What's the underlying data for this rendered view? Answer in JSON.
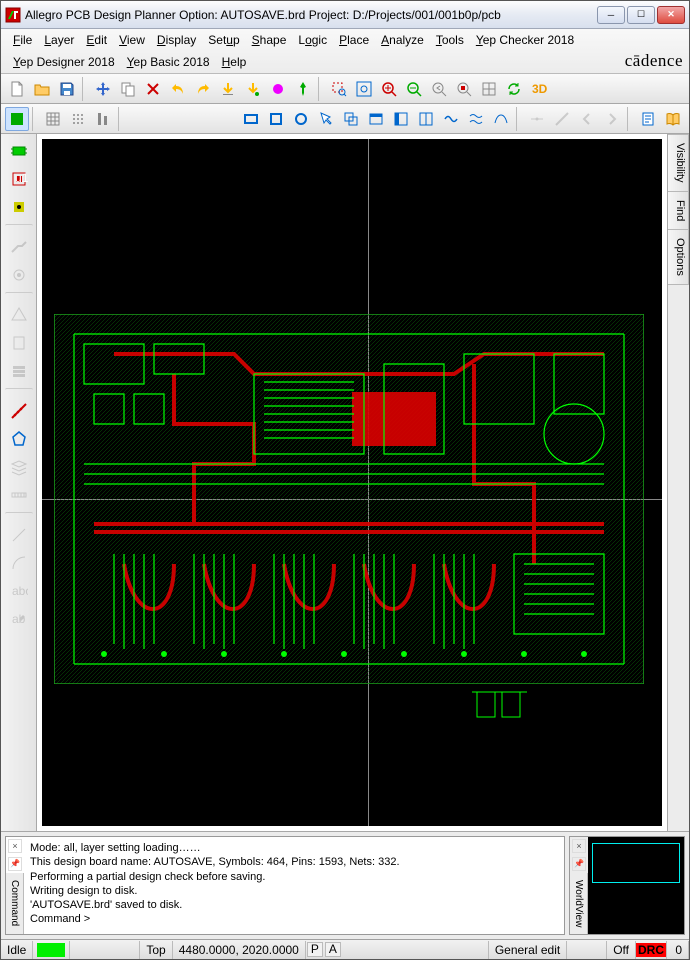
{
  "title": "Allegro PCB Design Planner Option: AUTOSAVE.brd  Project: D:/Projects/001/001b0p/pcb",
  "brand": "cādence",
  "menu": {
    "row1": [
      "File",
      "Layer",
      "Edit",
      "View",
      "Display",
      "Setup",
      "Shape",
      "Logic",
      "Place",
      "Analyze",
      "Tools",
      "Yep Checker 2018"
    ],
    "row2": [
      "Yep Designer 2018",
      "Yep Basic 2018",
      "Help"
    ]
  },
  "sidetabs": [
    "Visibility",
    "Find",
    "Options"
  ],
  "command_label": "Command",
  "command_log": "Mode: all, layer setting loading……\nThis design board name: AUTOSAVE, Symbols: 464, Pins: 1593, Nets: 332.\nPerforming a partial design check before saving.\nWriting design to disk.\n'AUTOSAVE.brd' saved to disk.\nCommand >",
  "worldview_label": "WorldView",
  "status": {
    "idle": "Idle",
    "layer": "Top",
    "coords": "4480.0000, 2020.0000",
    "p": "P",
    "a": "A",
    "mode": "General edit",
    "drc_state": "Off",
    "drc_label": "DRC",
    "drc_count": "0"
  }
}
